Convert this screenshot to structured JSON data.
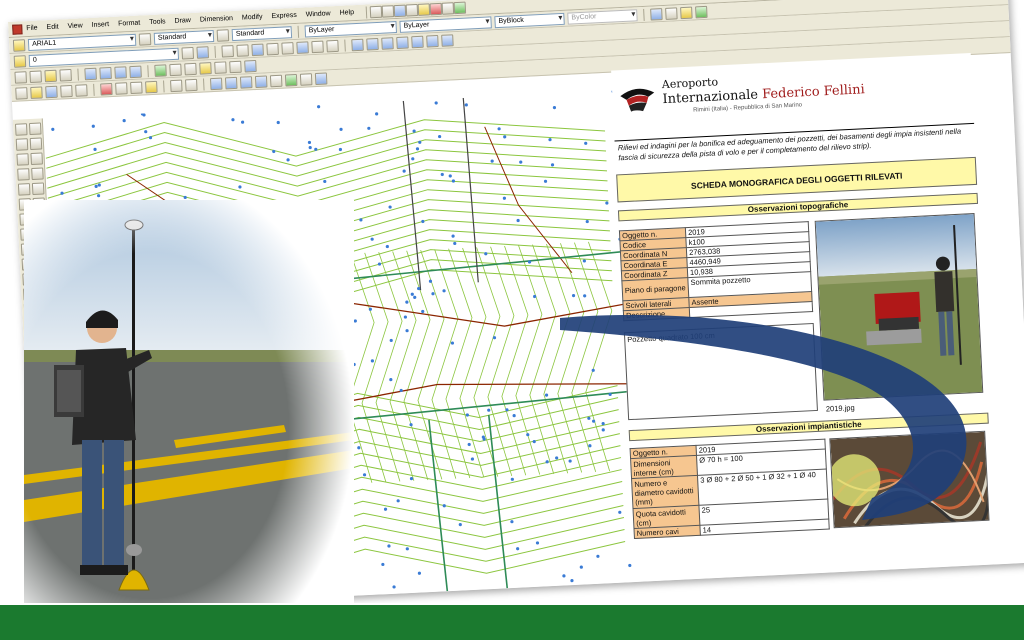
{
  "app": {
    "menu": [
      "File",
      "Edit",
      "View",
      "Insert",
      "Format",
      "Tools",
      "Draw",
      "Dimension",
      "Modify",
      "Express",
      "Window",
      "Help"
    ],
    "text_style": "ARIAL1",
    "dim_style": "Standard",
    "table_style": "Standard",
    "layer": "0",
    "color_layer": "ByLayer",
    "linetype": "ByLayer",
    "lineweight": "ByBlock",
    "plot_style": "ByColor",
    "layer_color_label": "ByLayer"
  },
  "sheet": {
    "logo_line1": "Aeroporto",
    "logo_line2_a": "Internazionale ",
    "logo_line2_b": "Federico Fellini",
    "logo_line3": "Rimini (Italia) - Repubblica di San Marino",
    "intro": "Rilievi ed indagini per la bonifica ed adeguamento dei pozzetti, dei basamenti degli impia insistenti nella fascia di sicurezza della pista di volo e per il completamento del rilievo strip).",
    "title": "SCHEDA MONOGRAFICA DEGLI OGGETTI RILEVATI",
    "topo_header": "Osservazioni topografiche",
    "topo_rows": [
      {
        "k": "Oggetto n.",
        "v": "2019"
      },
      {
        "k": "Codice",
        "v": "k100"
      },
      {
        "k": "Coordinata N",
        "v": "2763,038"
      },
      {
        "k": "Coordinata E",
        "v": "4460,949"
      },
      {
        "k": "Coordinata Z",
        "v": "10,938"
      },
      {
        "k": "Piano di paragone",
        "v": "Sommita pozzetto"
      },
      {
        "k": "Scivoli laterali",
        "v": "Assente"
      },
      {
        "k": "Descrizione",
        "v": ""
      }
    ],
    "description_text": "Pozzetto quadrato 100 cm",
    "photo_caption": "2019.jpg",
    "plant_header": "Osservazioni impiantistiche",
    "plant_rows": [
      {
        "k": "Oggetto n.",
        "v": "2019"
      },
      {
        "k": "Dimensioni interne (cm)",
        "v": "Ø 70 h = 100"
      },
      {
        "k": "Numero e diametro cavidotti (mm)",
        "v": "3 Ø 80 + 2 Ø 50 + 1 Ø 32 + 1 Ø 40"
      },
      {
        "k": "Quota cavidotti (cm)",
        "v": "25"
      },
      {
        "k": "Numero cavi",
        "v": "14"
      }
    ]
  },
  "colors": {
    "menu_bg": "#ece9d8",
    "contour_green": "#8cc63f",
    "contour_brown": "#8b2500",
    "point_blue": "#3a7bd5",
    "banner_yellow": "#fff9a8",
    "cell_orange": "#f6c690",
    "ribbon_navy": "#1f3f78",
    "footer_green": "#1b7a2f"
  }
}
